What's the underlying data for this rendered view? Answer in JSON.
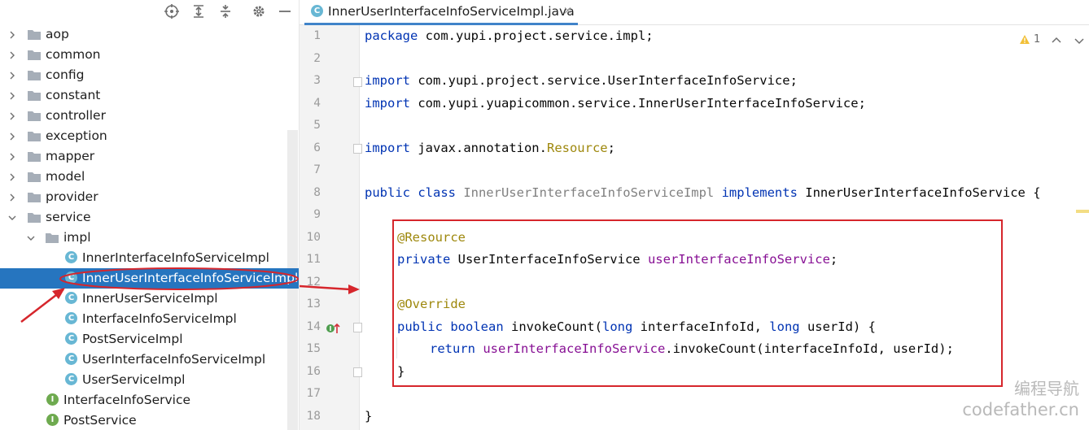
{
  "tree": {
    "folders": [
      {
        "label": "aop"
      },
      {
        "label": "common"
      },
      {
        "label": "config"
      },
      {
        "label": "constant"
      },
      {
        "label": "controller"
      },
      {
        "label": "exception"
      },
      {
        "label": "mapper"
      },
      {
        "label": "model"
      },
      {
        "label": "provider"
      },
      {
        "label": "service"
      },
      {
        "label": "impl"
      }
    ],
    "classes": [
      {
        "label": "InnerInterfaceInfoServiceImpl",
        "badge": "C"
      },
      {
        "label": "InnerUserInterfaceInfoServiceImpl",
        "badge": "C"
      },
      {
        "label": "InnerUserServiceImpl",
        "badge": "C"
      },
      {
        "label": "InterfaceInfoServiceImpl",
        "badge": "C"
      },
      {
        "label": "PostServiceImpl",
        "badge": "C"
      },
      {
        "label": "UserInterfaceInfoServiceImpl",
        "badge": "C"
      },
      {
        "label": "UserServiceImpl",
        "badge": "C"
      },
      {
        "label": "InterfaceInfoService",
        "badge": "I"
      },
      {
        "label": "PostService",
        "badge": "I"
      }
    ]
  },
  "editor": {
    "tab": {
      "badge": "C",
      "label": "InnerUserInterfaceInfoServiceImpl.java",
      "close": "×"
    },
    "line_numbers": [
      "1",
      "2",
      "3",
      "4",
      "5",
      "6",
      "7",
      "8",
      "9",
      "10",
      "11",
      "12",
      "13",
      "14",
      "15",
      "16",
      "17",
      "18"
    ],
    "code": {
      "l1_kw": "package",
      "l1_rest": " com.yupi.project.service.impl;",
      "l3_kw": "import",
      "l3_rest": " com.yupi.project.service.UserInterfaceInfoService;",
      "l4_kw": "import",
      "l4_rest": " com.yupi.yuapicommon.service.InnerUserInterfaceInfoService;",
      "l6_kw": "import",
      "l6_rest": " javax.annotation.",
      "l6_ann": "Resource",
      "l6_end": ";",
      "l8_kw": "public class",
      "l8_name": " InnerUserInterfaceInfoServiceImpl",
      "l8_kw2": " implements",
      "l8_rest": " InnerUserInterfaceInfoService {",
      "l10_ann": "@Resource",
      "l11_kw": "private",
      "l11_type": " UserInterfaceInfoService",
      "l11_field": " userInterfaceInfoService",
      "l11_end": ";",
      "l13_ann": "@Override",
      "l14_kw": "public boolean",
      "l14_a": " invokeCount(",
      "l14_kw2": "long",
      "l14_b": " interfaceInfoId,",
      "l14_kw3": " long",
      "l14_c": " userId) {",
      "l15_kw": "return",
      "l15_field": " userInterfaceInfoService",
      "l15_rest": ".invokeCount(interfaceInfoId, userId);",
      "l16": "}",
      "l18": "}"
    },
    "inspection": {
      "warnings": "1"
    }
  },
  "watermark": {
    "line1": "编程导航",
    "line2": "codefather.cn"
  },
  "colors": {
    "selection": "#2675bf",
    "annotation_red": "#d6262c",
    "keyword": "#0033b3",
    "field": "#871094"
  }
}
